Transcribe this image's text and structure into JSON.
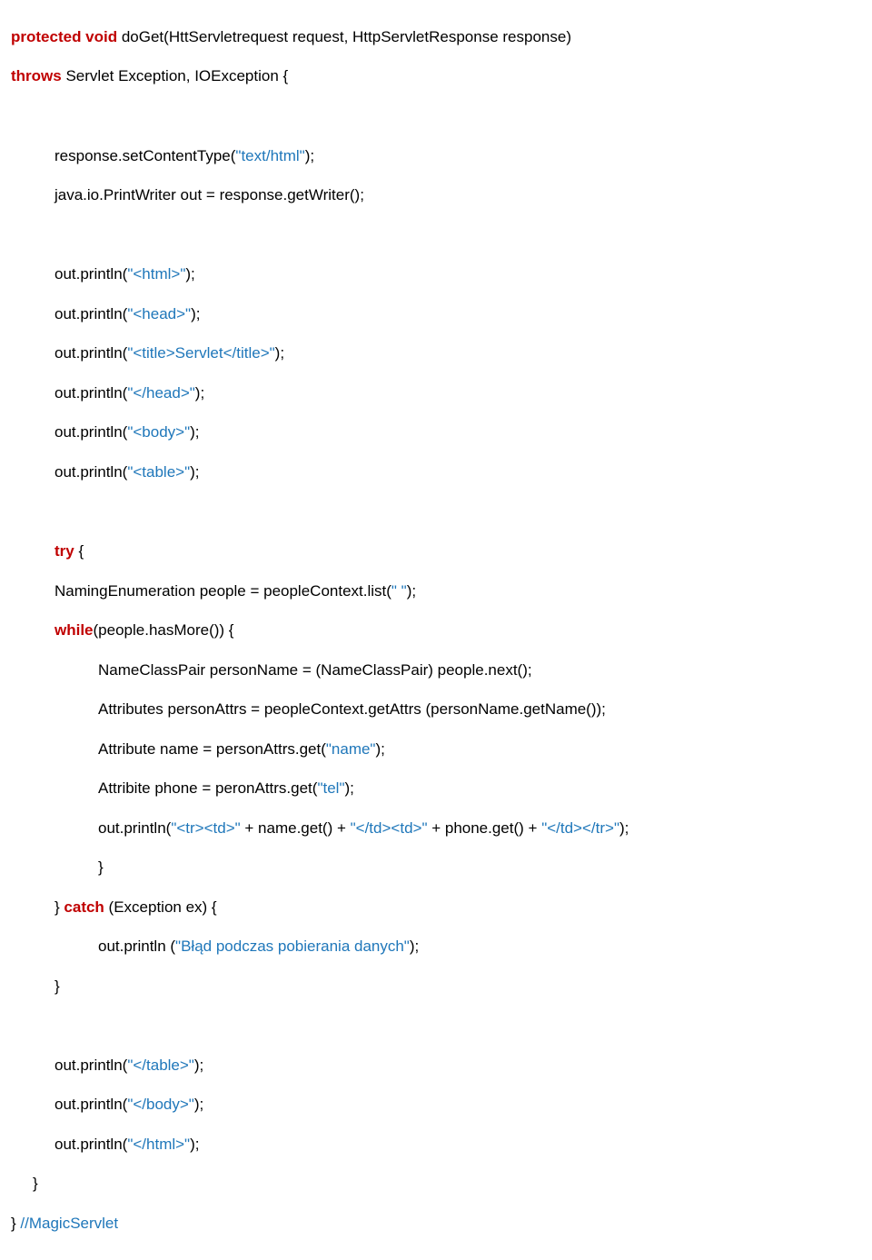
{
  "kw": {
    "protected": "protected void",
    "throws": "throws",
    "try": "try",
    "while": "while",
    "catch": "catch"
  },
  "sig1_a": " doGet(HttServletrequest request, HttpServletResponse response)",
  "sig2_a": " Servlet Exception, IOException {",
  "l3a": "response.setContentType(",
  "l3s": "\"text/html\"",
  "l3b": ");",
  "l4": "java.io.PrintWriter out = response.getWriter();",
  "l5a": "out.println(",
  "l5s": "\"<html>\"",
  "l5b": ");",
  "l6a": "out.println(",
  "l6s": "\"<head>\"",
  "l6b": ");",
  "l7a": "out.println(",
  "l7s": "\"<title>Servlet</title>\"",
  "l7b": ");",
  "l8a": "out.println(",
  "l8s": "\"</head>\"",
  "l8b": ");",
  "l9a": "out.println(",
  "l9s": "\"<body>\"",
  "l9b": ");",
  "l10a": "out.println(",
  "l10s": "\"<table>\"",
  "l10b": ");",
  "l11a": " {",
  "l12a": "NamingEnumeration people = peopleContext.list(",
  "l12s": "\" \"",
  "l12b": ");",
  "l13a": "(people.hasMore()) {",
  "l14": "NameClassPair personName = (NameClassPair) people.next();",
  "l15": "Attributes personAttrs = peopleContext.getAttrs (personName.getName());",
  "l16a": "Attribute name = personAttrs.get(",
  "l16s": "\"name\"",
  "l16b": ");",
  "l17a": "Attribite phone = peronAttrs.get(",
  "l17s": "\"tel\"",
  "l17b": ");",
  "l18a": "out.println(",
  "l18s1": "\"<tr><td>\"",
  "l18b": " + name.get() + ",
  "l18s2": "\"</td><td>\"",
  "l18c": " + phone.get() + ",
  "l18s3": "\"</td></tr>\"",
  "l18d": ");",
  "l19": "}",
  "l20a": "} ",
  "l20b": " (Exception ex) {",
  "l21a": "out.println (",
  "l21s": "\"Błąd podczas pobierania danych\"",
  "l21b": ");",
  "l22": "}",
  "l23a": "out.println(",
  "l23s": "\"</table>\"",
  "l23b": ");",
  "l24a": "out.println(",
  "l24s": "\"</body>\"",
  "l24b": ");",
  "l25a": "out.println(",
  "l25s": "\"</html>\"",
  "l25b": ");",
  "l26": "}",
  "l27a": "} ",
  "l27b": "//MagicServlet"
}
